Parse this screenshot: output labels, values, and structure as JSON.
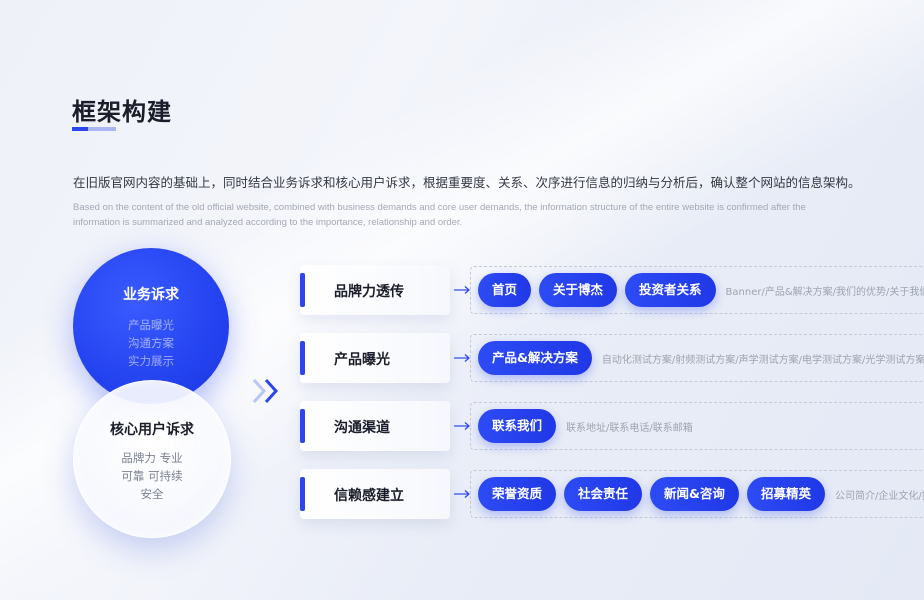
{
  "title": "框架构建",
  "description_cn": "在旧版官网内容的基础上，同时结合业务诉求和核心用户诉求，根据重要度、关系、次序进行信息的归纳与分析后，确认整个网站的信息架构。",
  "description_en": "Based on the content of the old official website, combined with business demands and core user demands, the information structure of the entire website is confirmed after the information is summarized and analyzed according to the importance, relationship and order.",
  "business_circle": {
    "title": "业务诉求",
    "items": [
      "产品曝光",
      "沟通方案",
      "实力展示"
    ]
  },
  "user_circle": {
    "title": "核心用户诉求",
    "items": [
      "品牌力 专业",
      "可靠 可持续",
      "安全"
    ]
  },
  "colors": {
    "accent": "#2b46ee",
    "pill": "#2443f0"
  },
  "rows": [
    {
      "title": "品牌力透传",
      "pills": [
        "首页",
        "关于博杰",
        "投资者关系"
      ],
      "subtext": "Banner/产品&解决方案/我们的优势/关于我们/投"
    },
    {
      "title": "产品曝光",
      "pills": [
        "产品&解决方案"
      ],
      "subtext": "自动化测试方案/射频测试方案/声学测试方案/电学测试方案/光学测试方案/视"
    },
    {
      "title": "沟通渠道",
      "pills": [
        "联系我们"
      ],
      "subtext": "联系地址/联系电话/联系邮箱"
    },
    {
      "title": "信赖感建立",
      "pills": [
        "荣誉资质",
        "社会责任",
        "新闻&咨询",
        "招募精英"
      ],
      "subtext": "公司简介/企业文化/技术"
    }
  ]
}
